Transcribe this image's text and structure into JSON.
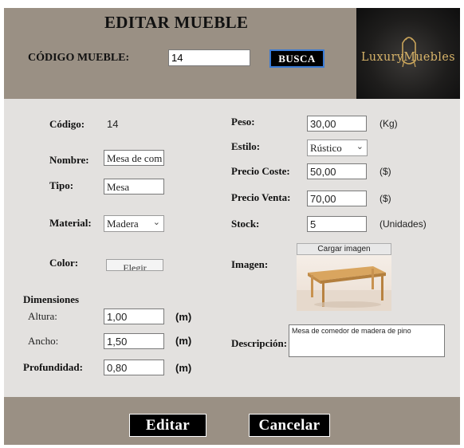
{
  "header": {
    "title": "EDITAR MUEBLE",
    "code_label": "CÓDIGO MUEBLE:",
    "code_value": "14",
    "search_button": "BUSCA",
    "logo_text": "LuxuryMuebles"
  },
  "form": {
    "codigo_label": "Código:",
    "codigo_value": "14",
    "nombre_label": "Nombre:",
    "nombre_value": "Mesa de com",
    "tipo_label": "Tipo:",
    "tipo_value": "Mesa",
    "material_label": "Material:",
    "material_value": "Madera",
    "color_label": "Color:",
    "color_button": "Elegir",
    "peso_label": "Peso:",
    "peso_value": "30,00",
    "peso_unit": "(Kg)",
    "estilo_label": "Estilo:",
    "estilo_value": "Rústico",
    "precio_coste_label": "Precio Coste:",
    "precio_coste_value": "50,00",
    "precio_coste_unit": "($)",
    "precio_venta_label": "Precio Venta:",
    "precio_venta_value": "70,00",
    "precio_venta_unit": "($)",
    "stock_label": "Stock:",
    "stock_value": "5",
    "stock_unit": "(Unidades)",
    "imagen_label": "Imagen:",
    "load_image_button": "Cargar imagen",
    "dimensiones_label": "Dimensiones",
    "altura_label": "Altura:",
    "altura_value": "1,00",
    "altura_unit": "(m)",
    "ancho_label": "Ancho:",
    "ancho_value": "1,50",
    "ancho_unit": "(m)",
    "profundidad_label": "Profundidad:",
    "profundidad_value": "0,80",
    "profundidad_unit": "(m)",
    "descripcion_label": "Descripción:",
    "descripcion_value": "Mesa de comedor de madera de pino"
  },
  "footer": {
    "edit_button": "Editar",
    "cancel_button": "Cancelar"
  },
  "colors": {
    "header_bg": "#9a9084",
    "body_bg": "#e3e1df",
    "logo_gold": "#c9a45a",
    "button_bg": "#000000"
  }
}
